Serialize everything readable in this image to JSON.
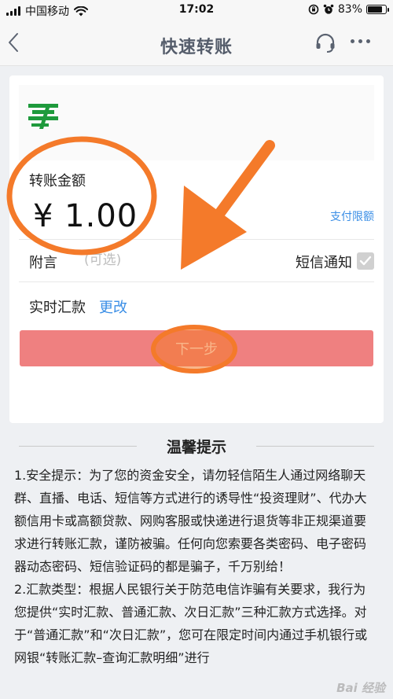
{
  "status_bar": {
    "carrier": "中国移动",
    "time": "17:02",
    "battery": "83%",
    "battery_level": 0.83
  },
  "nav": {
    "title": "快速转账"
  },
  "transfer": {
    "amount_label": "转账金额",
    "amount": "¥ 1.00",
    "pay_limit_link": "支付限额",
    "remark_label": "附言",
    "remark_placeholder": "(可选)",
    "sms_label": "短信通知",
    "sms_checked": true,
    "remit_label": "实时汇款",
    "remit_change": "更改",
    "next_button": "下一步"
  },
  "tips": {
    "title": "温馨提示",
    "items": [
      "1.安全提示：为了您的资金安全，请勿轻信陌生人通过网络聊天群、直播、电话、短信等方式进行的诱导性“投资理财”、代办大额信用卡或高额贷款、网购客服或快递进行退货等非正规渠道要求进行转账汇款，谨防被骗。任何向您索要各类密码、电子密码器动态密码、短信验证码的都是骗子，千万别给！",
      "2.汇款类型：根据人民银行关于防范电信诈骗有关要求，我行为您提供“实时汇款、普通汇款、次日汇款”三种汇款方式选择。对于“普通汇款”和“次日汇款”，您可在限定时间内通过手机银行或网银“转账汇款–查询汇款明细”进行"
    ]
  },
  "colors": {
    "accent_blue": "#3a8ee6",
    "next_button": "#ef8080",
    "annotation_orange": "#f47a2a",
    "bank_green": "#1e9a3c"
  },
  "watermark": "Bai 经验"
}
